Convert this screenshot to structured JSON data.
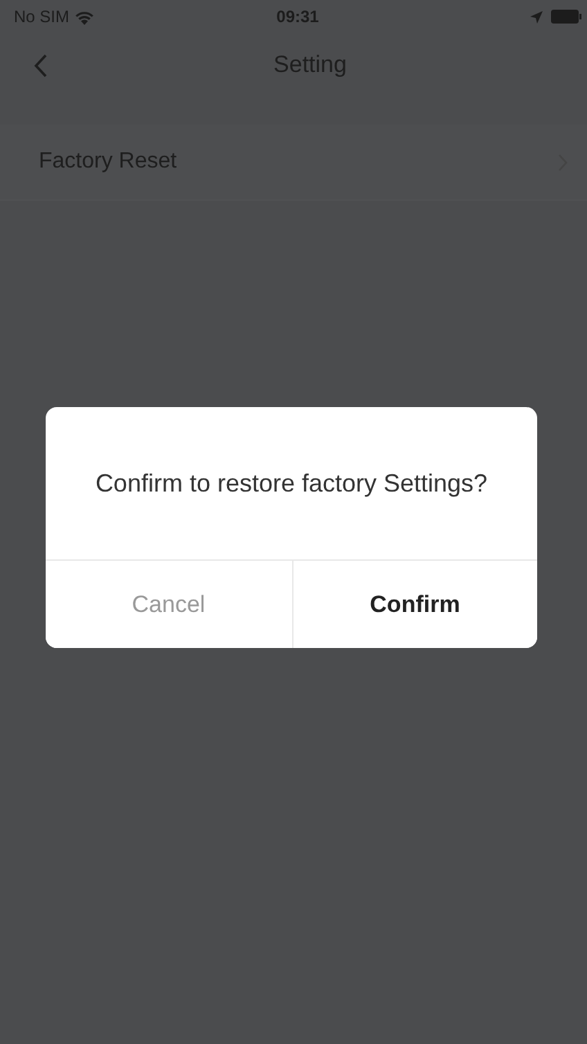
{
  "status_bar": {
    "carrier": "No SIM",
    "time": "09:31"
  },
  "nav": {
    "title": "Setting"
  },
  "rows": [
    {
      "label": "Factory Reset"
    }
  ],
  "dialog": {
    "message": "Confirm to restore factory Settings?",
    "buttons": [
      {
        "label": "Cancel",
        "primary": false
      },
      {
        "label": "Confirm",
        "primary": true
      }
    ]
  }
}
